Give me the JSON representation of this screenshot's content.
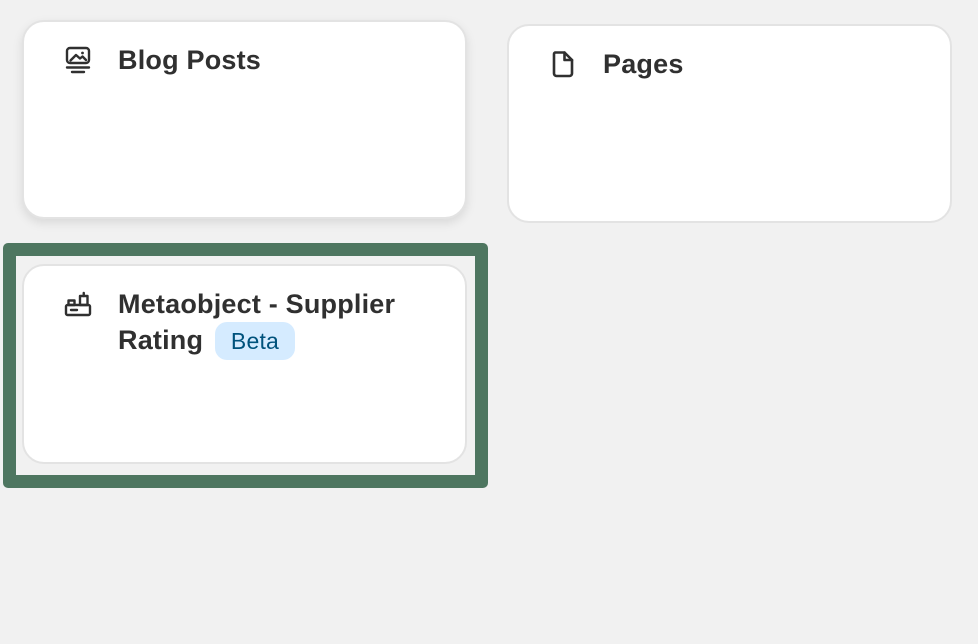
{
  "cards": {
    "blog_posts": {
      "title": "Blog Posts",
      "icon": "image-icon"
    },
    "pages": {
      "title": "Pages",
      "icon": "page-icon"
    },
    "metaobject": {
      "title": "Metaobject - Supplier Rating",
      "badge": "Beta",
      "icon": "metaobject-icon"
    }
  },
  "colors": {
    "page_background": "#f1f1f1",
    "card_background": "#ffffff",
    "focus_frame": "#4e7660",
    "badge_background": "#d5ebff",
    "badge_text": "#00527c",
    "title_text": "#303030"
  }
}
